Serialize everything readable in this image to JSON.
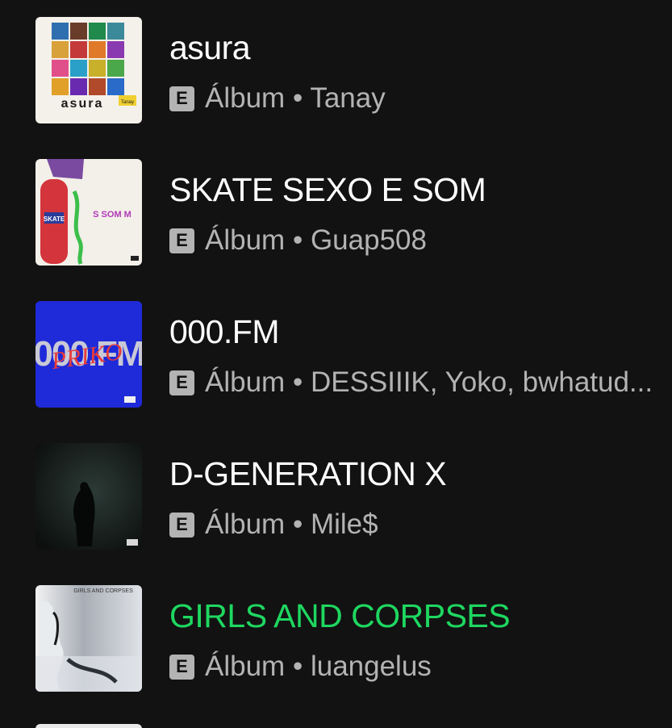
{
  "colors": {
    "background": "#121212",
    "title": "#ffffff",
    "title_playing": "#1ed760",
    "subtitle": "#b3b3b3"
  },
  "explicit_label": "E",
  "separator": "•",
  "albums": [
    {
      "title": "asura",
      "type": "Álbum",
      "artist": "Tanay",
      "explicit": true,
      "playing": false,
      "cover_text": "asura",
      "cover_subtext": "Tanay"
    },
    {
      "title": "SKATE SEXO E SOM",
      "type": "Álbum",
      "artist": "Guap508",
      "explicit": true,
      "playing": false,
      "cover_text": "SKATE",
      "cover_subtext": "S SOM M"
    },
    {
      "title": "000.FM",
      "type": "Álbum",
      "artist": "DESSIIIK, Yoko, bwhatud...",
      "explicit": true,
      "playing": false,
      "cover_text": "000.FM",
      "cover_subtext": "PRIKO"
    },
    {
      "title": "D-GENERATION X",
      "type": "Álbum",
      "artist": "Mile$",
      "explicit": true,
      "playing": false
    },
    {
      "title": "GIRLS AND CORPSES",
      "type": "Álbum",
      "artist": "luangelus",
      "explicit": true,
      "playing": true,
      "cover_text": "GIRLS AND CORPSES"
    }
  ]
}
